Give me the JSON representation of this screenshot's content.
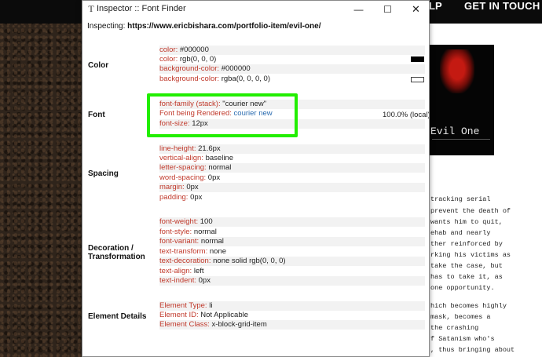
{
  "site": {
    "nav": {
      "help_partial": "LP",
      "get_in_touch": "GET IN TOUCH"
    },
    "poster_title": "Evil One",
    "text_lines": [
      "tracking serial",
      "prevent the death of",
      " wants him to quit,",
      "ehab and nearly",
      "ther reinforced by",
      "rking his victims as",
      " take the case, but",
      " has to take it, as",
      " one opportunity.",
      "hich becomes highly",
      "mask, becomes a",
      " the crashing",
      "f Satanism who's",
      ", thus bringing about"
    ]
  },
  "window": {
    "title": "Inspector :: Font Finder",
    "controls": {
      "minimize": "—",
      "maximize": "☐",
      "close": "✕"
    },
    "inspecting_label": "Inspecting:",
    "inspecting_url": "https://www.ericbishara.com/portfolio-item/evil-one/"
  },
  "sections": {
    "color": {
      "label": "Color",
      "rows": [
        {
          "prop": "color:",
          "value": "#000000"
        },
        {
          "prop": "color:",
          "value": "rgb(0, 0, 0)"
        },
        {
          "prop": "background-color:",
          "value": "#000000"
        },
        {
          "prop": "background-color:",
          "value": "rgba(0, 0, 0, 0)"
        }
      ]
    },
    "font": {
      "label": "Font",
      "rows": [
        {
          "prop": "font-family (stack):",
          "value": "\"courier new\""
        },
        {
          "prop": "Font being Rendered:",
          "value": "courier new",
          "extra": "100.0% (local)"
        },
        {
          "prop": "font-size:",
          "value": "12px"
        }
      ]
    },
    "spacing": {
      "label": "Spacing",
      "rows": [
        {
          "prop": "line-height:",
          "value": "21.6px"
        },
        {
          "prop": "vertical-align:",
          "value": "baseline"
        },
        {
          "prop": "letter-spacing:",
          "value": "normal"
        },
        {
          "prop": "word-spacing:",
          "value": "0px"
        },
        {
          "prop": "margin:",
          "value": "0px"
        },
        {
          "prop": "padding:",
          "value": "0px"
        }
      ]
    },
    "decoration": {
      "label_line1": "Decoration /",
      "label_line2": "Transformation",
      "rows": [
        {
          "prop": "font-weight:",
          "value": "100"
        },
        {
          "prop": "font-style:",
          "value": "normal"
        },
        {
          "prop": "font-variant:",
          "value": "normal"
        },
        {
          "prop": "text-transform:",
          "value": "none"
        },
        {
          "prop": "text-decoration:",
          "value": "none solid rgb(0, 0, 0)"
        },
        {
          "prop": "text-align:",
          "value": "left"
        },
        {
          "prop": "text-indent:",
          "value": "0px"
        }
      ]
    },
    "element": {
      "label": "Element Details",
      "rows": [
        {
          "prop": "Element Type:",
          "value": "li"
        },
        {
          "prop": "Element ID:",
          "value": "Not Applicable"
        },
        {
          "prop": "Element Class:",
          "value": "x-block-grid-item"
        }
      ]
    }
  },
  "colors": {
    "highlight": "#22ee00",
    "prop_text": "#c0392b",
    "link": "#2b6cb0"
  }
}
